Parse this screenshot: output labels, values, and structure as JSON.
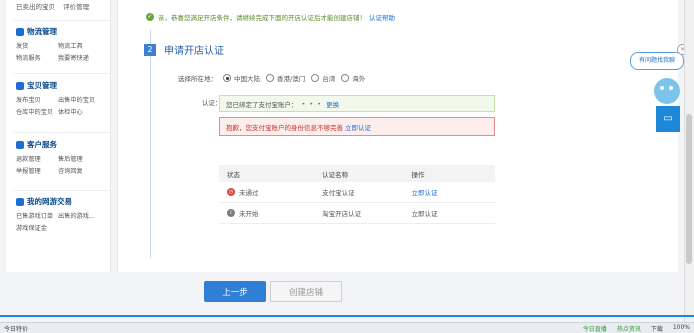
{
  "sidebar": {
    "top_links": [
      "已卖出的宝贝",
      "评价管理"
    ],
    "groups": [
      {
        "title": "物流管理",
        "items": [
          "发货",
          "物流工具",
          "物流服务",
          "我要寄快递"
        ]
      },
      {
        "title": "宝贝管理",
        "items": [
          "发布宝贝",
          "出售中的宝贝",
          "仓库中的宝贝",
          "体检中心"
        ]
      },
      {
        "title": "客户服务",
        "items": [
          "退款管理",
          "售后管理",
          "举报管理",
          "咨询回复"
        ]
      },
      {
        "title": "我的网游交易",
        "items": [
          "已售游戏订单",
          "出售的游戏...",
          "游戏保证金",
          ""
        ]
      }
    ]
  },
  "main": {
    "notice": "亲，恭喜您满足开店条件，请继续完成下面的开店认证后才能创建店铺！",
    "notice_link": "认证帮助",
    "step_number": "2",
    "step_title": "申请开店认证",
    "region_label": "选择所在地：",
    "regions": [
      {
        "label": "中国大陆",
        "selected": true
      },
      {
        "label": "香港/澳门",
        "selected": false
      },
      {
        "label": "台湾",
        "selected": false
      },
      {
        "label": "海外",
        "selected": false
      }
    ],
    "cert_label": "认证：",
    "alipay_bound_text": "您已绑定了支付宝账户：",
    "alipay_account_masked": "• • •",
    "alipay_change_link": "更换",
    "error_text": "抱歉，您支付宝账户的身份信息不够完善",
    "error_link": "立即认证",
    "table": {
      "headers": [
        "状态",
        "认证名称",
        "操作"
      ],
      "rows": [
        {
          "status": "未通过",
          "status_icon": "clock-icon",
          "name": "支付宝认证",
          "action": "立即认证",
          "action_is_link": true
        },
        {
          "status": "未开始",
          "status_icon": "info-icon",
          "name": "淘宝开店认证",
          "action": "立即认证",
          "action_is_link": false
        }
      ]
    },
    "prev_button": "上一步",
    "create_button": "创建店铺"
  },
  "widgets": {
    "help_bubble": "有问题找我聊",
    "chat_icon": "chat-icon"
  },
  "statusbar": {
    "left": "今日特价",
    "right": [
      "今日直播",
      "热点资讯",
      "下载",
      "100%"
    ]
  },
  "colors": {
    "accent": "#2f7fd6",
    "error": "#c8332b",
    "success": "#6aa639"
  }
}
